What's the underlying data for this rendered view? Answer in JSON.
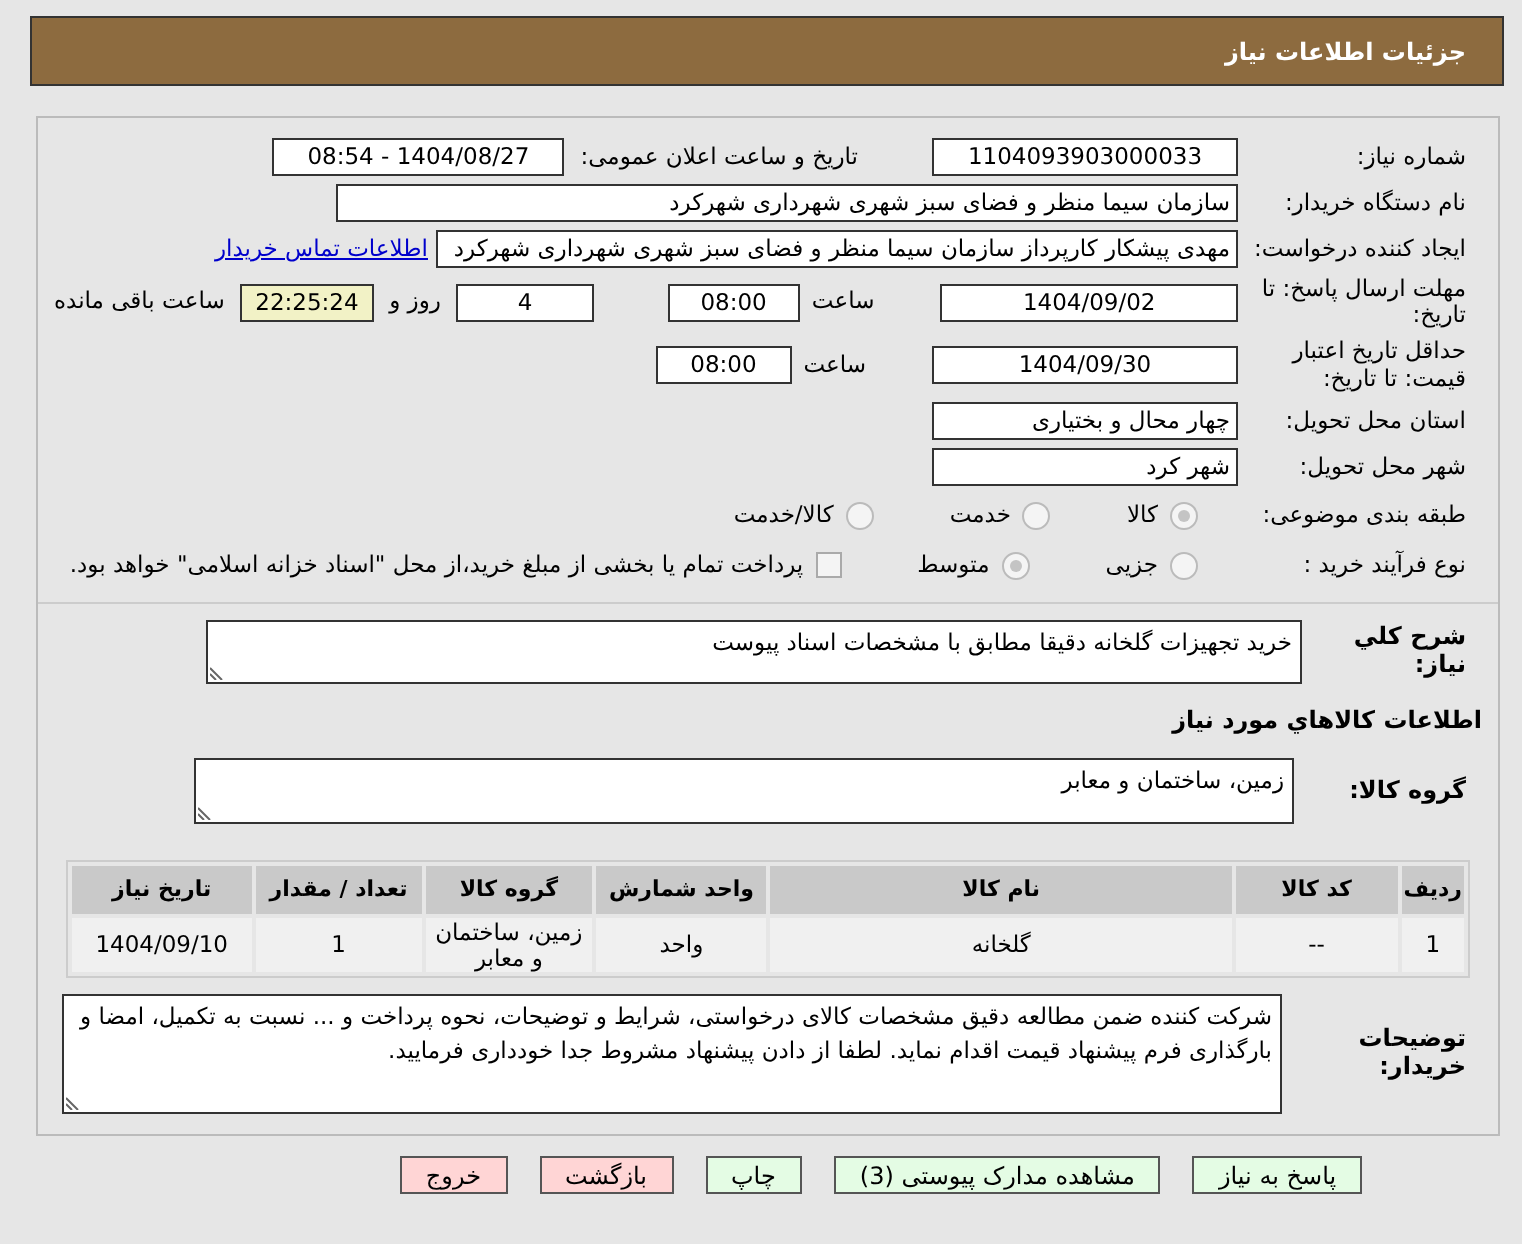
{
  "page_title": "جزئیات اطلاعات نیاز",
  "need_number": {
    "label": "شماره نیاز:",
    "value": "1104093903000033"
  },
  "announce": {
    "label": "تاریخ و ساعت اعلان عمومی:",
    "value": "1404/08/27 - 08:54"
  },
  "buyer_org": {
    "label": "نام دستگاه خریدار:",
    "value": "سازمان سیما منظر و فضای سبز شهری شهرداری شهرکرد"
  },
  "requester": {
    "label": "ایجاد کننده درخواست:",
    "value": "مهدی پیشکار کارپرداز سازمان سیما منظر و فضای سبز شهری شهرداری شهرکرد",
    "link": "اطلاعات تماس خریدار"
  },
  "deadline": {
    "label": "مهلت ارسال پاسخ: تا تاریخ:",
    "date": "1404/09/02",
    "time_label": "ساعت",
    "time": "08:00",
    "days": "4",
    "days_label": "روز و",
    "remaining": "22:25:24",
    "remaining_label": "ساعت باقی مانده"
  },
  "validity": {
    "label": "حداقل تاریخ اعتبار قیمت: تا تاریخ:",
    "date": "1404/09/30",
    "time_label": "ساعت",
    "time": "08:00"
  },
  "province": {
    "label": "استان محل تحویل:",
    "value": "چهار محال و بختیاری"
  },
  "city": {
    "label": "شهر محل تحویل:",
    "value": "شهر کرد"
  },
  "category": {
    "label": "طبقه بندی موضوعی:",
    "options": [
      {
        "label": "کالا",
        "selected": true
      },
      {
        "label": "خدمت",
        "selected": false
      },
      {
        "label": "کالا/خدمت",
        "selected": false
      }
    ]
  },
  "process": {
    "label": "نوع فرآیند خرید :",
    "options": [
      {
        "label": "جزیی",
        "selected": false
      },
      {
        "label": "متوسط",
        "selected": true
      }
    ],
    "payment": {
      "label": "پرداخت تمام یا بخشی از مبلغ خرید،از محل \"اسناد خزانه اسلامی\" خواهد بود.",
      "checked": false
    }
  },
  "description": {
    "label": "شرح کلي نیاز:",
    "value": "خرید تجهیزات گلخانه دقیقا مطابق با مشخصات اسناد پیوست"
  },
  "goods_heading": "اطلاعات کالاهاي مورد نیاز",
  "goods_group": {
    "label": "گروه کالا:",
    "value": "زمین، ساختمان و معابر"
  },
  "table": {
    "columns": [
      "ردیف",
      "کد کالا",
      "نام کالا",
      "واحد شمارش",
      "گروه کالا",
      "تعداد / مقدار",
      "تاریخ نیاز"
    ],
    "rows": [
      [
        "1",
        "--",
        "گلخانه",
        "واحد",
        "زمین، ساختمان و معابر",
        "1",
        "1404/09/10"
      ]
    ]
  },
  "notes": {
    "label": "توضیحات خریدار:",
    "value": "شرکت کننده ضمن مطالعه دقیق مشخصات کالای درخواستی، شرایط و توضیحات، نحوه پرداخت و ... نسبت به تکمیل، امضا و بارگذاری فرم پیشنهاد قیمت اقدام نماید. لطفا از دادن پیشنهاد مشروط جدا خودداری فرمایید."
  },
  "buttons": [
    {
      "label": "پاسخ به نیاز",
      "kind": "action"
    },
    {
      "label": "مشاهده مدارک پیوستی (3)",
      "kind": "action"
    },
    {
      "label": "چاپ",
      "kind": "action"
    },
    {
      "label": "بازگشت",
      "kind": "exit"
    },
    {
      "label": "خروج",
      "kind": "exit"
    }
  ]
}
